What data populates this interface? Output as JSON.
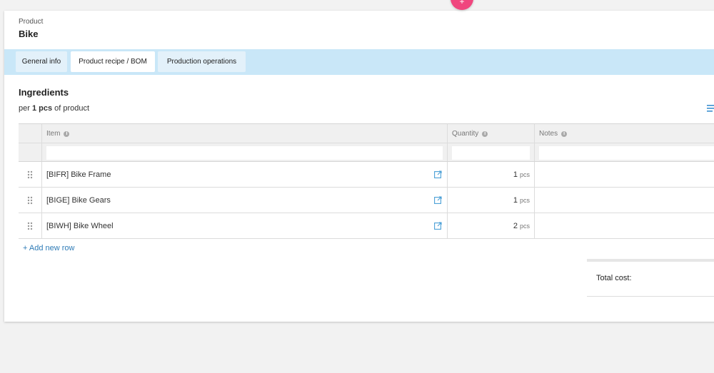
{
  "fab": {
    "label": "+",
    "color": "#f0467e"
  },
  "product": {
    "label": "Product",
    "name": "Bike"
  },
  "tabs": [
    {
      "label": "General info",
      "active": false
    },
    {
      "label": "Product recipe / BOM",
      "active": true
    },
    {
      "label": "Production operations",
      "active": false
    }
  ],
  "ingredients": {
    "title": "Ingredients",
    "per_prefix": "per",
    "per_qty": "1 pcs",
    "per_suffix": "of product",
    "columns": [
      "Item",
      "Quantity",
      "Notes"
    ],
    "rows": [
      {
        "item": "[BIFR] Bike Frame",
        "quantity": "1",
        "unit": "pcs",
        "notes": ""
      },
      {
        "item": "[BIGE] Bike Gears",
        "quantity": "1",
        "unit": "pcs",
        "notes": ""
      },
      {
        "item": "[BIWH] Bike Wheel",
        "quantity": "2",
        "unit": "pcs",
        "notes": ""
      }
    ],
    "add_row_label": "+ Add new row",
    "total_cost_label": "Total cost:"
  },
  "colors": {
    "tab_bar": "#c9e7f8",
    "link": "#2e7bb6",
    "accent": "#f0467e"
  }
}
